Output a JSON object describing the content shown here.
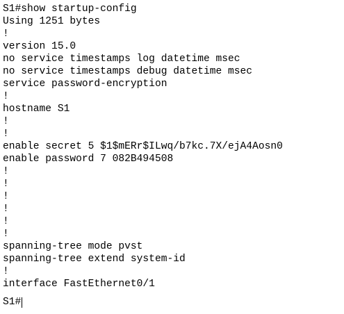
{
  "terminal": {
    "lines": [
      "S1#show startup-config",
      "Using 1251 bytes",
      "!",
      "version 15.0",
      "no service timestamps log datetime msec",
      "no service timestamps debug datetime msec",
      "service password-encryption",
      "!",
      "hostname S1",
      "!",
      "!",
      "enable secret 5 $1$mERr$ILwq/b7kc.7X/ejA4Aosn0",
      "enable password 7 082B494508",
      "!",
      "!",
      "!",
      "!",
      "!",
      "!",
      "spanning-tree mode pvst",
      "spanning-tree extend system-id",
      "!",
      "interface FastEthernet0/1"
    ],
    "prompt": "S1#"
  }
}
